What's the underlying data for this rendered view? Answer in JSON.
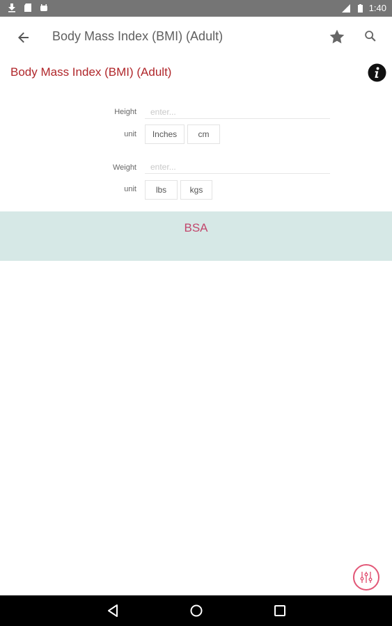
{
  "status_bar": {
    "time": "1:40",
    "icons": [
      "download-icon",
      "sd-card-icon",
      "android-icon",
      "signal-icon",
      "battery-icon"
    ]
  },
  "app_bar": {
    "title": "Body Mass Index (BMI) (Adult)",
    "icons": [
      "back-arrow-icon",
      "star-icon",
      "search-icon"
    ]
  },
  "calculator": {
    "heading": "Body Mass Index (BMI) (Adult)",
    "info_icon": "info-icon",
    "height": {
      "label": "Height",
      "placeholder": "enter...",
      "unit_label": "unit",
      "units": [
        "Inches",
        "cm"
      ]
    },
    "weight": {
      "label": "Weight",
      "placeholder": "enter...",
      "unit_label": "unit",
      "units": [
        "lbs",
        "kgs"
      ]
    },
    "result_label": "BSA"
  },
  "fab_icon": "sliders-icon",
  "nav_bar": {
    "icons": [
      "back-triangle-icon",
      "home-circle-icon",
      "recents-square-icon"
    ]
  },
  "colors": {
    "heading": "#b0262a",
    "result_band": "#d6e8e6",
    "result_text": "#c2466c",
    "fab_accent": "#e25777"
  }
}
